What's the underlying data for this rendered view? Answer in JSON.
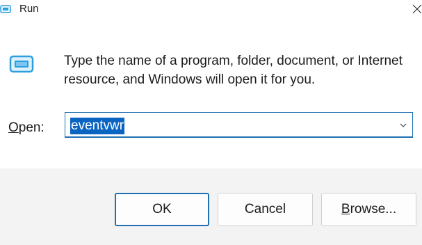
{
  "window": {
    "title": "Run",
    "title_icon": "run-icon",
    "close_icon": "close-icon"
  },
  "body": {
    "icon": "run-icon",
    "description": "Type the name of a program, folder, document, or Internet resource, and Windows will open it for you.",
    "open_label_accel": "O",
    "open_label_rest": "pen:",
    "open_value": "eventvwr",
    "dropdown_icon": "chevron-down-icon"
  },
  "buttons": {
    "ok": "OK",
    "cancel": "Cancel",
    "browse_accel": "B",
    "browse_rest": "rowse..."
  },
  "colors": {
    "accent": "#1f6fb2",
    "selection": "#0a64c2",
    "footer_bg": "#f3f3f3",
    "icon_blue": "#2b9fe0"
  }
}
